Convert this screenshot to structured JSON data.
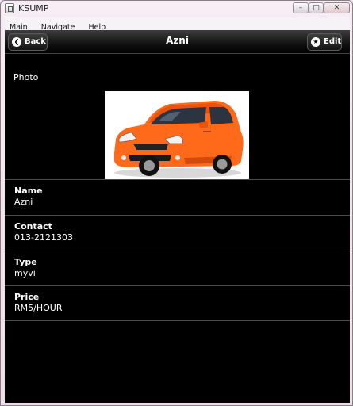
{
  "window": {
    "title": "KSUMP",
    "controls": {
      "minimize": "–",
      "maximize": "□",
      "close": "✕"
    }
  },
  "menubar": {
    "items": [
      "Main",
      "Navigate",
      "Help"
    ]
  },
  "header": {
    "back_label": "Back",
    "back_icon": "chevron-left-icon",
    "title": "Azni",
    "edit_label": "Edit",
    "edit_icon": "star-icon"
  },
  "photo": {
    "label": "Photo",
    "subject": "orange hatchback car"
  },
  "fields": [
    {
      "label": "Name",
      "value": "Azni"
    },
    {
      "label": "Contact",
      "value": "013-2121303"
    },
    {
      "label": "Type",
      "value": "myvi"
    },
    {
      "label": "Price",
      "value": "RM5/HOUR"
    }
  ],
  "colors": {
    "background": "#000000",
    "text": "#ffffff",
    "car": "#ff6a1a"
  }
}
